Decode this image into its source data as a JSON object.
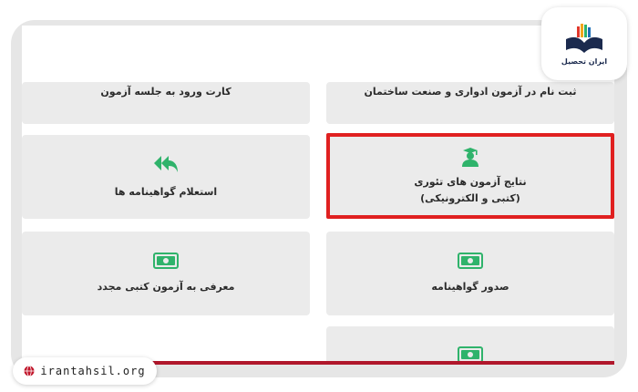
{
  "tiles": {
    "card_entry": "کارت ورود به جلسه آزمون",
    "register": "ثبت نام در آزمون ادواری و صنعت ساختمان",
    "certificate_inquiry": "استعلام گواهینامه ها",
    "results_line1": "نتایج آزمون های تئوری",
    "results_line2": "(کتبی و الکترونیکی)",
    "reintroduce": "معرفی به آزمون کتبی مجدد",
    "issue_certificate": "صدور گواهینامه"
  },
  "logo": {
    "text": "ایران تحصیل"
  },
  "site": {
    "url": "irantahsil.org"
  },
  "colors": {
    "tile_bg": "#ebebeb",
    "icon_green": "#2fb36b",
    "highlight": "#e02020",
    "bar": "#b0172b"
  }
}
